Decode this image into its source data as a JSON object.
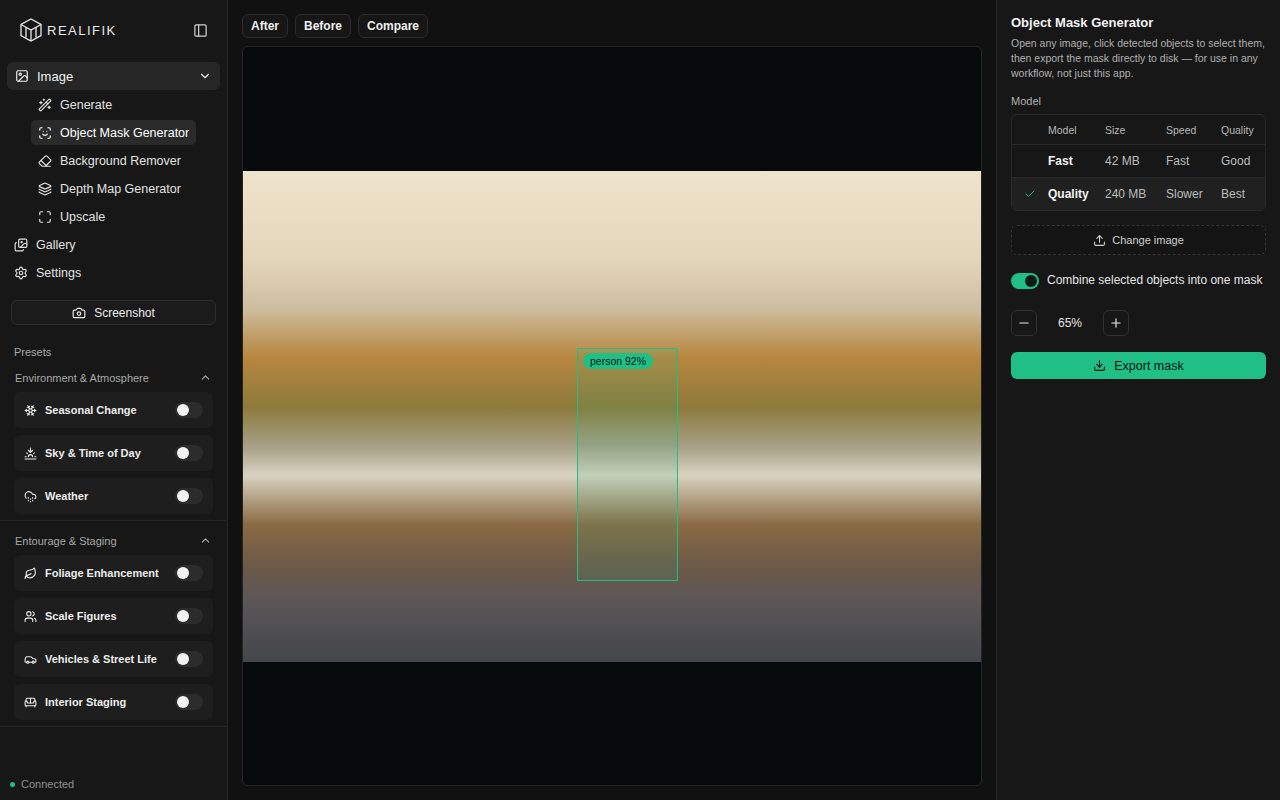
{
  "brand": {
    "name": "REALIFIK"
  },
  "nav": {
    "group": {
      "label": "Image",
      "expanded": true
    },
    "subitems": [
      {
        "label": "Generate",
        "selected": false
      },
      {
        "label": "Object Mask Generator",
        "selected": true
      },
      {
        "label": "Background Remover",
        "selected": false
      },
      {
        "label": "Depth Map Generator",
        "selected": false
      },
      {
        "label": "Upscale",
        "selected": false
      }
    ],
    "items": [
      {
        "label": "Gallery",
        "selected": false
      },
      {
        "label": "Settings",
        "selected": false
      }
    ]
  },
  "screenshot_button": "Screenshot",
  "presets": {
    "title": "Presets",
    "sections": [
      {
        "title": "Environment & Atmosphere",
        "expanded": true,
        "items": [
          {
            "label": "Seasonal Change",
            "on": false
          },
          {
            "label": "Sky & Time of Day",
            "on": false
          },
          {
            "label": "Weather",
            "on": false
          }
        ]
      },
      {
        "title": "Entourage & Staging",
        "expanded": true,
        "items": [
          {
            "label": "Foliage Enhancement",
            "on": false
          },
          {
            "label": "Scale Figures",
            "on": false
          },
          {
            "label": "Vehicles & Street Life",
            "on": false
          },
          {
            "label": "Interior Staging",
            "on": false
          }
        ]
      }
    ]
  },
  "status": {
    "label": "Connected",
    "connected": true
  },
  "view_tabs": [
    {
      "label": "After",
      "selected": false
    },
    {
      "label": "Before",
      "selected": false
    },
    {
      "label": "Compare",
      "selected": false
    }
  ],
  "detections": [
    {
      "label": "person 92%",
      "selected": true
    }
  ],
  "panel": {
    "title": "Object Mask Generator",
    "description": "Open any image, click detected objects to select them, then export the mask directly to disk — for use in any workflow, not just this app.",
    "model_label": "Model",
    "model_columns": [
      "Model",
      "Size",
      "Speed",
      "Quality"
    ],
    "models": [
      {
        "name": "Fast",
        "size": "42 MB",
        "speed": "Fast",
        "quality": "Good",
        "selected": false
      },
      {
        "name": "Quality",
        "size": "240 MB",
        "speed": "Slower",
        "quality": "Best",
        "selected": true
      }
    ],
    "change_image": "Change image",
    "combine": {
      "label": "Combine selected objects into one mask",
      "on": true
    },
    "opacity": {
      "value": "65%"
    },
    "export_button": "Export mask"
  }
}
